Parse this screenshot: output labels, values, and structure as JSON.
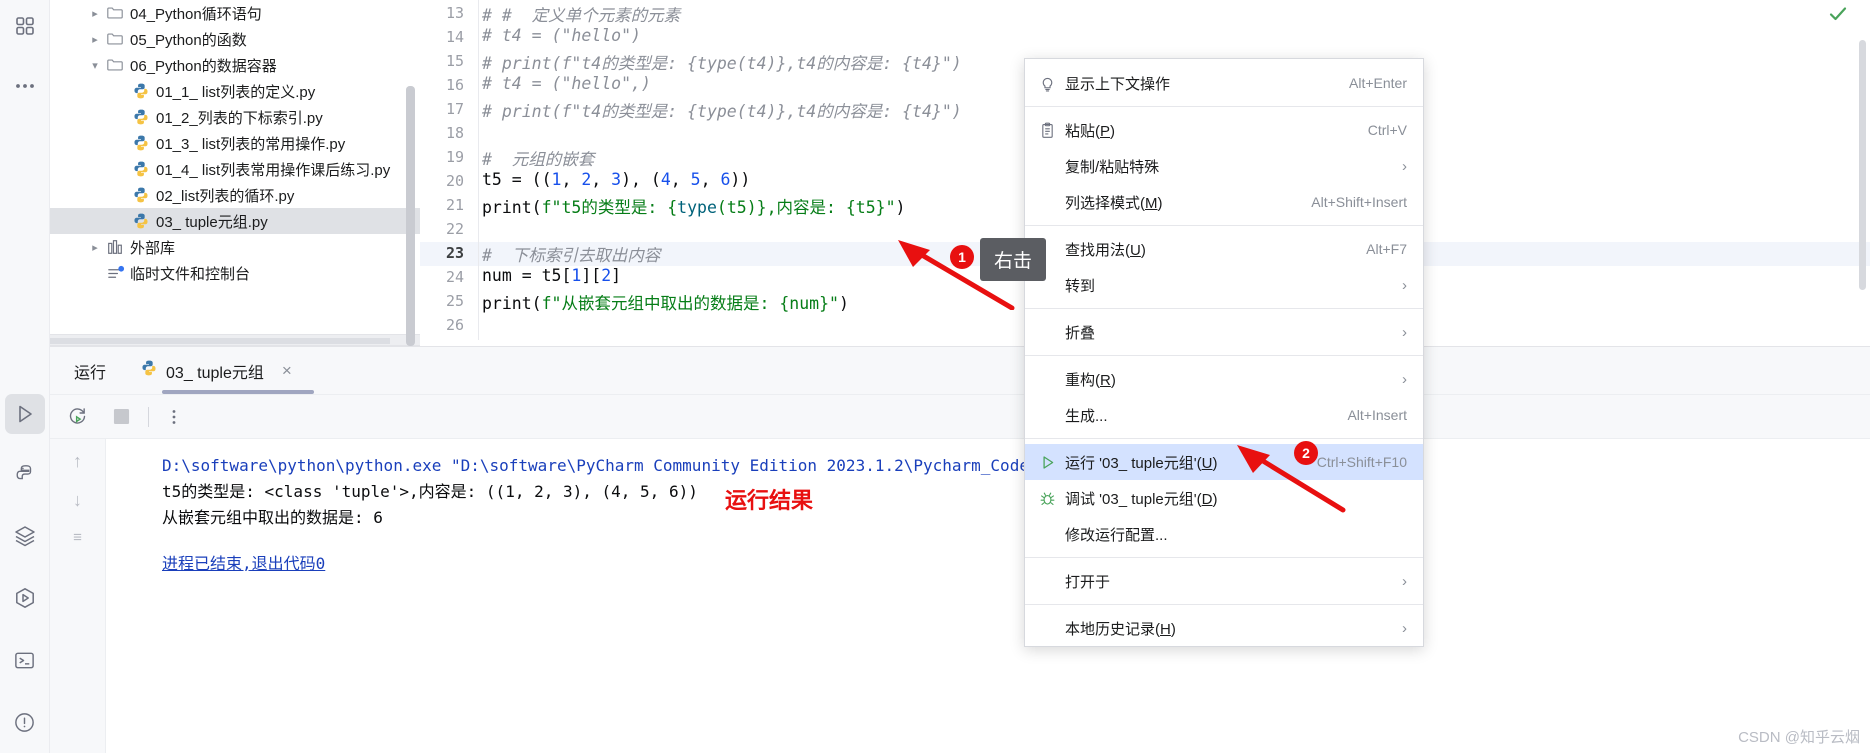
{
  "rail": {
    "icons": [
      {
        "name": "project-view-icon",
        "glyph": "grid"
      },
      {
        "name": "more-options-icon",
        "glyph": "dots"
      },
      {
        "name": "run-tool-window-icon",
        "glyph": "play"
      },
      {
        "name": "python-packages-icon",
        "glyph": "python"
      },
      {
        "name": "database-layers-icon",
        "glyph": "layers"
      },
      {
        "name": "python-console-icon",
        "glyph": "hexplay"
      },
      {
        "name": "terminal-icon",
        "glyph": "terminal"
      },
      {
        "name": "problems-icon",
        "glyph": "warning"
      },
      {
        "name": "todo-icon",
        "glyph": "list"
      },
      {
        "name": "print-icon",
        "glyph": "printer"
      }
    ]
  },
  "tree": {
    "items": [
      {
        "label": "04_Python循环语句",
        "icon": "folder-icon",
        "chevron": "right",
        "indent": 1,
        "selected": false
      },
      {
        "label": "05_Python的函数",
        "icon": "folder-icon",
        "chevron": "right",
        "indent": 1,
        "selected": false
      },
      {
        "label": "06_Python的数据容器",
        "icon": "folder-icon",
        "chevron": "down",
        "indent": 1,
        "selected": false
      },
      {
        "label": "01_1_ list列表的定义.py",
        "icon": "python-file-icon",
        "chevron": "",
        "indent": 2,
        "selected": false
      },
      {
        "label": "01_2_列表的下标索引.py",
        "icon": "python-file-icon",
        "chevron": "",
        "indent": 2,
        "selected": false
      },
      {
        "label": "01_3_ list列表的常用操作.py",
        "icon": "python-file-icon",
        "chevron": "",
        "indent": 2,
        "selected": false
      },
      {
        "label": "01_4_ list列表常用操作课后练习.py",
        "icon": "python-file-icon",
        "chevron": "",
        "indent": 2,
        "selected": false
      },
      {
        "label": "02_list列表的循环.py",
        "icon": "python-file-icon",
        "chevron": "",
        "indent": 2,
        "selected": false
      },
      {
        "label": "03_ tuple元组.py",
        "icon": "python-file-icon",
        "chevron": "",
        "indent": 2,
        "selected": true
      },
      {
        "label": "外部库",
        "icon": "library-icon",
        "chevron": "right",
        "indent": 1,
        "selected": false
      },
      {
        "label": "临时文件和控制台",
        "icon": "scratches-icon",
        "chevron": "",
        "indent": 1,
        "selected": false
      }
    ]
  },
  "editor": {
    "current_line": 23,
    "lines": [
      {
        "no": 13,
        "html": "<span class='cmt'># #  定义单个元素的元素</span>"
      },
      {
        "no": 14,
        "html": "<span class='cmt'># t4 = (\"hello\")</span>"
      },
      {
        "no": 15,
        "html": "<span class='cmt'># print(f\"t4的类型是: {type(t4)},t4的内容是: {t4}\")</span>"
      },
      {
        "no": 16,
        "html": "<span class='cmt'># t4 = (\"hello\",)</span>"
      },
      {
        "no": 17,
        "html": "<span class='cmt'># print(f\"t4的类型是: {type(t4)},t4的内容是: {t4}\")</span>"
      },
      {
        "no": 18,
        "html": ""
      },
      {
        "no": 19,
        "html": "<span class='cmt'>#  元组的嵌套</span>"
      },
      {
        "no": 20,
        "html": "t5 = ((<span class='num'>1</span>, <span class='num'>2</span>, <span class='num'>3</span>), (<span class='num'>4</span>, <span class='num'>5</span>, <span class='num'>6</span>))"
      },
      {
        "no": 21,
        "html": "print(<span class='str'>f\"t5的类型是: {</span><span class='fn'>type</span><span class='str'>(t5)},内容是: {t5}\"</span>)"
      },
      {
        "no": 22,
        "html": ""
      },
      {
        "no": 23,
        "html": "<span class='cmt'>#  下标索引去取出内容</span>"
      },
      {
        "no": 24,
        "html": "num = t5[<span class='num'>1</span>][<span class='num'>2</span>]"
      },
      {
        "no": 25,
        "html": "print(<span class='str'>f\"从嵌套元组中取出的数据是: {num}\"</span>)"
      },
      {
        "no": 26,
        "html": ""
      }
    ],
    "inspection_status": "ok-check"
  },
  "run_panel": {
    "title": "运行",
    "tab_label": "03_ tuple元组",
    "tab_close": "×",
    "toolbar": {
      "rerun_label": "rerun-icon",
      "stop_label": "stop-icon",
      "more_label": "more-icon"
    },
    "console": {
      "lines": [
        {
          "text": "D:\\software\\python\\python.exe \"D:\\software\\PyCharm Community Edition 2023.1.2\\Pycharm_Code\\06_Python的数据容器\\03_ tuple元组.py\"",
          "style": "path"
        },
        {
          "text": "t5的类型是: <class 'tuple'>,内容是: ((1, 2, 3), (4, 5, 6))",
          "style": "plain"
        },
        {
          "text": "从嵌套元组中取出的数据是: 6",
          "style": "plain"
        },
        {
          "text": "",
          "style": "gap"
        },
        {
          "text": "进程已结束,退出代码0",
          "style": "link"
        }
      ]
    }
  },
  "context_menu": {
    "items": [
      {
        "label": "显示上下文操作",
        "shortcut": "Alt+Enter",
        "icon": "lightbulb-icon",
        "arrow": false,
        "highlighted": false,
        "mnemonic": ""
      },
      {
        "sep": true
      },
      {
        "label": "粘贴(P)",
        "shortcut": "Ctrl+V",
        "icon": "clipboard-icon",
        "arrow": false,
        "highlighted": false,
        "mnemonic": "P"
      },
      {
        "label": "复制/粘贴特殊",
        "shortcut": "",
        "icon": "",
        "arrow": true,
        "highlighted": false,
        "mnemonic": ""
      },
      {
        "label": "列选择模式(M)",
        "shortcut": "Alt+Shift+Insert",
        "icon": "",
        "arrow": false,
        "highlighted": false,
        "mnemonic": "M"
      },
      {
        "sep": true
      },
      {
        "label": "查找用法(U)",
        "shortcut": "Alt+F7",
        "icon": "",
        "arrow": false,
        "highlighted": false,
        "mnemonic": "U"
      },
      {
        "label": "转到",
        "shortcut": "",
        "icon": "",
        "arrow": true,
        "highlighted": false,
        "mnemonic": ""
      },
      {
        "sep": true
      },
      {
        "label": "折叠",
        "shortcut": "",
        "icon": "",
        "arrow": true,
        "highlighted": false,
        "mnemonic": ""
      },
      {
        "sep": true
      },
      {
        "label": "重构(R)",
        "shortcut": "",
        "icon": "",
        "arrow": true,
        "highlighted": false,
        "mnemonic": "R"
      },
      {
        "label": "生成...",
        "shortcut": "Alt+Insert",
        "icon": "",
        "arrow": false,
        "highlighted": false,
        "mnemonic": ""
      },
      {
        "sep": true
      },
      {
        "label": "运行 '03_ tuple元组'(U)",
        "shortcut": "Ctrl+Shift+F10",
        "icon": "run-green-icon",
        "arrow": false,
        "highlighted": true,
        "mnemonic": "U"
      },
      {
        "label": "调试 '03_ tuple元组'(D)",
        "shortcut": "",
        "icon": "debug-bug-icon",
        "arrow": false,
        "highlighted": false,
        "mnemonic": "D"
      },
      {
        "label": "修改运行配置...",
        "shortcut": "",
        "icon": "",
        "arrow": false,
        "highlighted": false,
        "mnemonic": ""
      },
      {
        "sep": true
      },
      {
        "label": "打开于",
        "shortcut": "",
        "icon": "",
        "arrow": true,
        "highlighted": false,
        "mnemonic": ""
      },
      {
        "sep": true
      },
      {
        "label": "本地历史记录(H)",
        "shortcut": "",
        "icon": "",
        "arrow": true,
        "highlighted": false,
        "mnemonic": "H"
      }
    ]
  },
  "annotations": {
    "tooltip_right_click": "右击",
    "badge_one": "1",
    "badge_two": "2",
    "run_result_label": "运行结果"
  },
  "watermark": "CSDN @知乎云烟",
  "colors": {
    "accent_red": "#e81010",
    "menu_highlight": "#d4e2ff",
    "selection_gray": "#dfe1e5",
    "comment_gray": "#8b9098",
    "string_green": "#067d17",
    "number_blue": "#1750eb",
    "console_path_blue": "#1a3fbb"
  }
}
